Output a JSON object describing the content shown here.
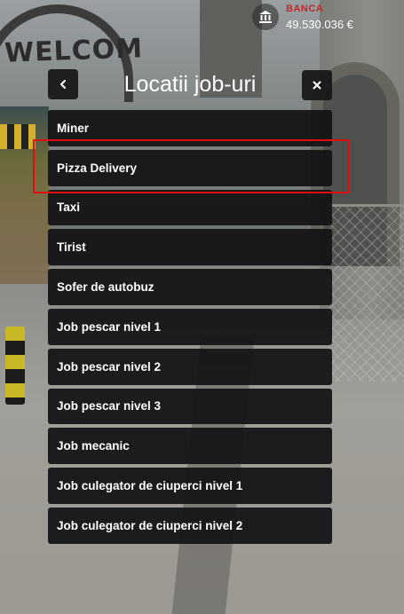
{
  "hud": {
    "bank_label": "BANCA",
    "bank_amount": "49.530.036 €",
    "bank_icon": "bank-icon"
  },
  "scene": {
    "sign_text": "WELCOM"
  },
  "panel": {
    "title": "Locatii job-uri",
    "back_icon": "chevron-left-icon",
    "close_icon": "close-icon",
    "jobs": [
      {
        "label": "Miner"
      },
      {
        "label": "Pizza Delivery",
        "highlighted": true
      },
      {
        "label": "Taxi"
      },
      {
        "label": "Tirist"
      },
      {
        "label": "Sofer de autobuz"
      },
      {
        "label": "Job pescar nivel 1"
      },
      {
        "label": "Job pescar nivel 2"
      },
      {
        "label": "Job pescar nivel 3"
      },
      {
        "label": "Job mecanic"
      },
      {
        "label": "Job culegator de ciuperci nivel 1"
      },
      {
        "label": "Job culegator de ciuperci nivel 2"
      }
    ]
  },
  "colors": {
    "panel_bg": "#161618",
    "text": "#ffffff",
    "bank_label": "#c02727",
    "highlight_border": "#e00d0d"
  }
}
